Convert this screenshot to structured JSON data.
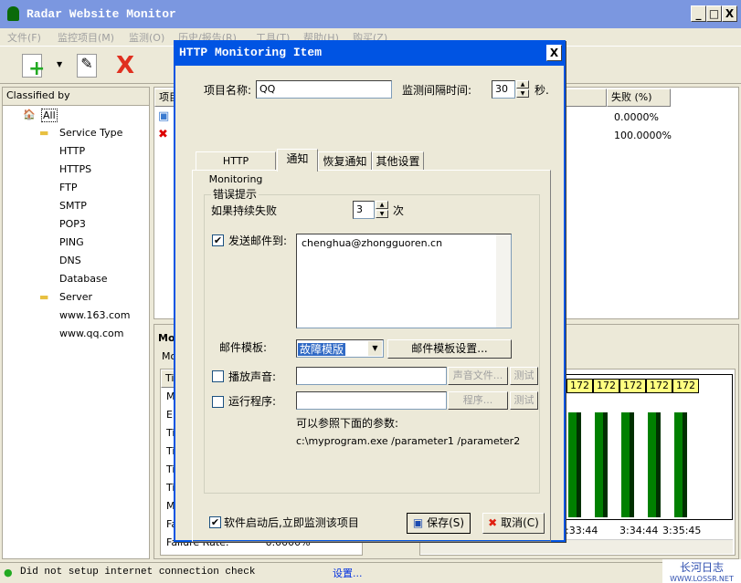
{
  "app": {
    "title": "Radar Website Monitor",
    "minimize": "_",
    "maximize": "□",
    "close": "X"
  },
  "menu": [
    "文件(F)",
    "监控项目(M)",
    "监测(O)",
    "历史/报告(R)",
    "工具(T)",
    "帮助(H)",
    "购买(Z)"
  ],
  "tree": {
    "header": "Classified by",
    "root": "All",
    "group1": "Service Type",
    "types": [
      "HTTP",
      "HTTPS",
      "FTP",
      "SMTP",
      "POP3",
      "PING",
      "DNS",
      "Database"
    ],
    "group2": "Server",
    "servers": [
      "www.163.com",
      "www.qq.com"
    ]
  },
  "list": {
    "col1": "项目",
    "col_fail": "失败 (%)",
    "rows": [
      {
        "fail": "0.0000%",
        "status": "ok"
      },
      {
        "fail": "100.0000%",
        "status": "error"
      }
    ]
  },
  "bottom": {
    "title": "Mo",
    "tab": "Mo",
    "col": "Tit",
    "rows": [
      "M",
      "El",
      "Ti",
      "Ti",
      "Ti",
      "Ti",
      "M",
      "Fa"
    ],
    "failure_label": "Failure Rate:",
    "failure_value": "0.0000%"
  },
  "chart": {
    "labels": [
      "172",
      "172",
      "172",
      "172",
      "172"
    ],
    "times": [
      "3:33:44",
      "3:34:44",
      "3:35:45"
    ]
  },
  "status": {
    "text": "Did not setup internet connection check",
    "link": "设置..."
  },
  "watermark": {
    "text": "长河日志",
    "url": "WWW.LOSSR.NET"
  },
  "dialog": {
    "title": "HTTP Monitoring Item",
    "close": "X",
    "name_label": "项目名称:",
    "name_value": "QQ",
    "interval_label": "监测间隔时间:",
    "interval_value": "30",
    "interval_unit": "秒.",
    "tabs": [
      "HTTP Monitoring",
      "通知",
      "恢复通知",
      "其他设置"
    ],
    "active_tab": 1,
    "group_title": "错误提示",
    "fail_label": "如果持续失败",
    "fail_value": "3",
    "fail_unit": "次",
    "email_checked": true,
    "email_label": "发送邮件到:",
    "email_value": "chenghua@zhongguoren.cn",
    "template_label": "邮件模板:",
    "template_value": "故障模版",
    "template_button": "邮件模板设置...",
    "sound_checked": false,
    "sound_label": "播放声音:",
    "sound_button": "声音文件...",
    "test1": "测试",
    "program_checked": false,
    "program_label": "运行程序:",
    "program_button": "程序...",
    "test2": "测试",
    "hint": "可以参照下面的参数:",
    "example": "c:\\myprogram.exe /parameter1 /parameter2",
    "startup_checked": true,
    "startup_label": "软件启动后,立即监测该项目",
    "save": "保存(S)",
    "cancel": "取消(C)"
  }
}
